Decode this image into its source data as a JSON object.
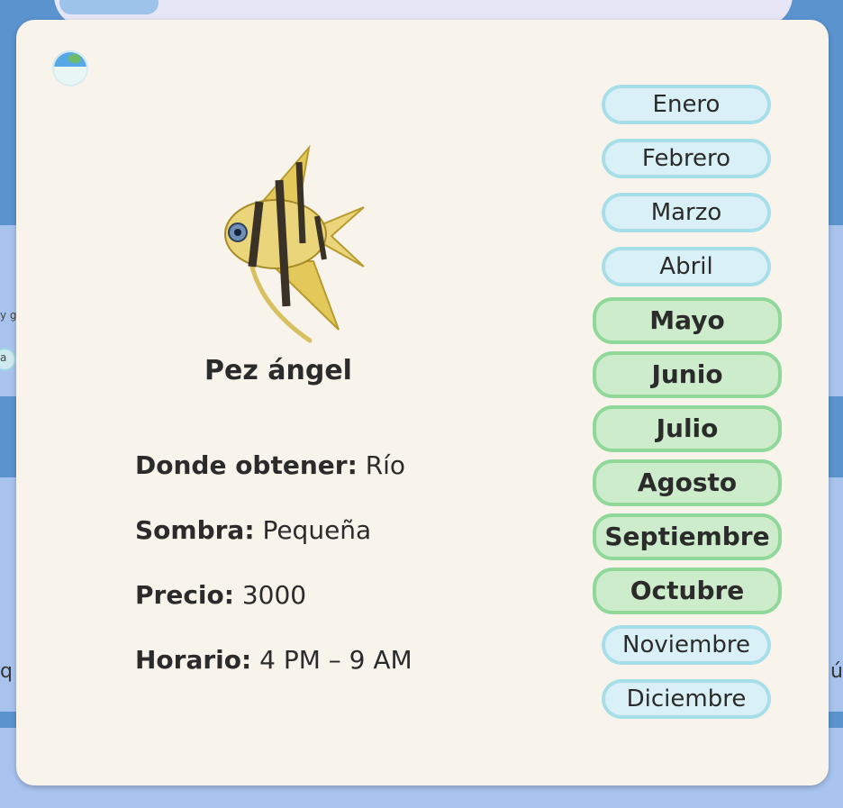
{
  "background": {
    "left_fragment_1": "y g",
    "left_fragment_2": "a",
    "left_fragment_3": "q",
    "right_fragment_1": "ú"
  },
  "detail": {
    "name": "Pez ángel",
    "fields": [
      {
        "label": "Donde obtener:",
        "value": "Río"
      },
      {
        "label": "Sombra:",
        "value": "Pequeña"
      },
      {
        "label": "Precio:",
        "value": "3000"
      },
      {
        "label": "Horario:",
        "value": "4 PM – 9 AM"
      }
    ],
    "icon": "globe-icon",
    "image": "angelfish-image"
  },
  "months": [
    {
      "label": "Enero",
      "active": false
    },
    {
      "label": "Febrero",
      "active": false
    },
    {
      "label": "Marzo",
      "active": false
    },
    {
      "label": "Abril",
      "active": false
    },
    {
      "label": "Mayo",
      "active": true
    },
    {
      "label": "Junio",
      "active": true
    },
    {
      "label": "Julio",
      "active": true
    },
    {
      "label": "Agosto",
      "active": true
    },
    {
      "label": "Septiembre",
      "active": true
    },
    {
      "label": "Octubre",
      "active": true
    },
    {
      "label": "Noviembre",
      "active": false
    },
    {
      "label": "Diciembre",
      "active": false
    }
  ],
  "colors": {
    "active_month_bg": "#cdeccb",
    "active_month_border": "#8fd89a",
    "inactive_month_bg": "#d9f1f6",
    "inactive_month_border": "#a6dfea",
    "modal_bg": "#f8f4ec",
    "page_bg": "#5b93cf"
  }
}
